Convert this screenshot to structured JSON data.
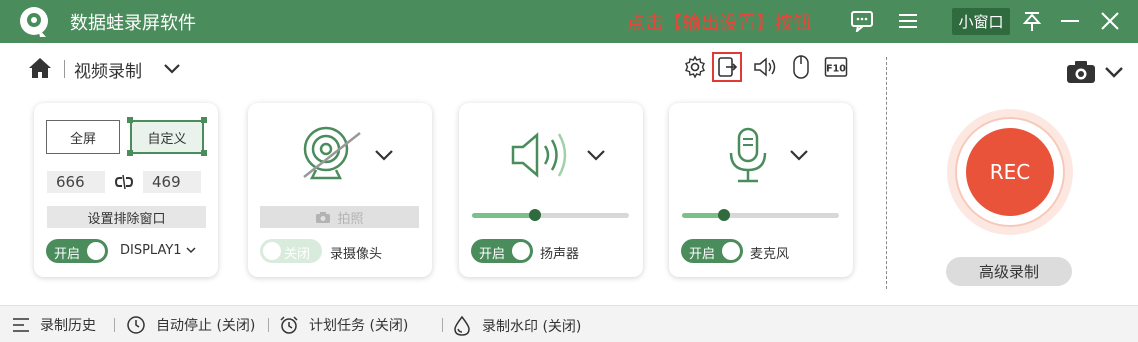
{
  "app": {
    "title": "数据蛙录屏软件",
    "annotation": "点击【输出设置】按钮"
  },
  "titlebar": {
    "icons": [
      "chat-icon",
      "menu-icon",
      "pin-icon",
      "minimize-icon",
      "close-icon"
    ],
    "mini_window_label": "小窗口"
  },
  "breadcrumb": {
    "home_icon": "home-icon",
    "title": "视频录制"
  },
  "toolbar": {
    "icons": [
      "gear-icon",
      "output-settings-icon",
      "speaker-icon",
      "mouse-icon",
      "f10-hotkey-icon"
    ],
    "f10_label": "F10"
  },
  "screen_card": {
    "full_label": "全屏",
    "custom_label": "自定义",
    "width": "666",
    "height": "469",
    "exclude_label": "设置排除窗口",
    "toggle_label": "开启",
    "display_label": "DISPLAY1"
  },
  "camera_card": {
    "photo_label": "拍照",
    "toggle_label": "关闭",
    "label": "录摄像头"
  },
  "speaker_card": {
    "toggle_label": "开启",
    "label": "扬声器",
    "volume": 0.4
  },
  "mic_card": {
    "toggle_label": "开启",
    "label": "麦克风",
    "volume": 0.27
  },
  "rec": {
    "label": "REC",
    "advanced_label": "高级录制"
  },
  "bottom": {
    "history": "录制历史",
    "auto_stop": "自动停止 (关闭)",
    "schedule": "计划任务 (关闭)",
    "watermark": "录制水印 (关闭)"
  },
  "colors": {
    "brand": "#4a8c5c",
    "rec": "#e8533a",
    "annotation": "#e8463a"
  }
}
